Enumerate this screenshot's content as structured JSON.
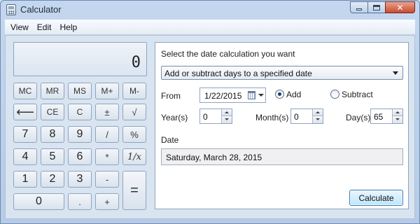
{
  "window": {
    "title": "Calculator",
    "min_glyph": "",
    "max_glyph": "",
    "close_glyph": "✕"
  },
  "menu": [
    "View",
    "Edit",
    "Help"
  ],
  "display": {
    "value": "0"
  },
  "keys": {
    "mc": "MC",
    "mr": "MR",
    "ms": "MS",
    "mplus": "M+",
    "mminus": "M-",
    "backspace": "⟵",
    "ce": "CE",
    "c": "C",
    "plusminus": "±",
    "sqrt": "√",
    "d7": "7",
    "d8": "8",
    "d9": "9",
    "divide": "/",
    "percent": "%",
    "d4": "4",
    "d5": "5",
    "d6": "6",
    "multiply": "*",
    "reciprocal": "1/x",
    "d1": "1",
    "d2": "2",
    "d3": "3",
    "minus": "-",
    "equals": "=",
    "d0": "0",
    "decimal": ".",
    "plus": "+"
  },
  "date_calc": {
    "heading": "Select the date calculation you want",
    "mode": "Add or subtract days to a specified date",
    "from_label": "From",
    "from_date": "1/22/2015",
    "add_label": "Add",
    "subtract_label": "Subtract",
    "selected_operation": "Add",
    "years_label": "Year(s)",
    "years_value": "0",
    "months_label": "Month(s)",
    "months_value": "0",
    "days_label": "Day(s)",
    "days_value": "65",
    "result_label": "Date",
    "result_value": "Saturday, March 28, 2015",
    "calculate_label": "Calculate"
  }
}
